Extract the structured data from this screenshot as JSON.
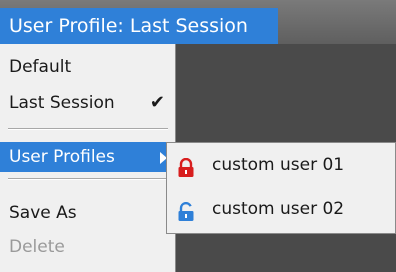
{
  "header": {
    "title": "User Profile: Last Session"
  },
  "menu": {
    "items": [
      {
        "label": "Default"
      },
      {
        "label": "Last Session",
        "checked": true,
        "check_glyph": "✔"
      },
      {
        "label": "User Profiles",
        "has_submenu": true
      },
      {
        "label": "Save As"
      },
      {
        "label": "Delete",
        "disabled": true
      }
    ]
  },
  "submenu": {
    "items": [
      {
        "label": "custom user 01",
        "icon": "lock-closed-icon",
        "icon_color": "#d81e1e"
      },
      {
        "label": "custom user 02",
        "icon": "lock-open-icon",
        "icon_color": "#2f80d8"
      }
    ]
  },
  "colors": {
    "accent": "#2f80d8",
    "menu_bg": "#f0f0f0",
    "app_bg": "#4a4a4a",
    "disabled_text": "#9a9a9a"
  }
}
